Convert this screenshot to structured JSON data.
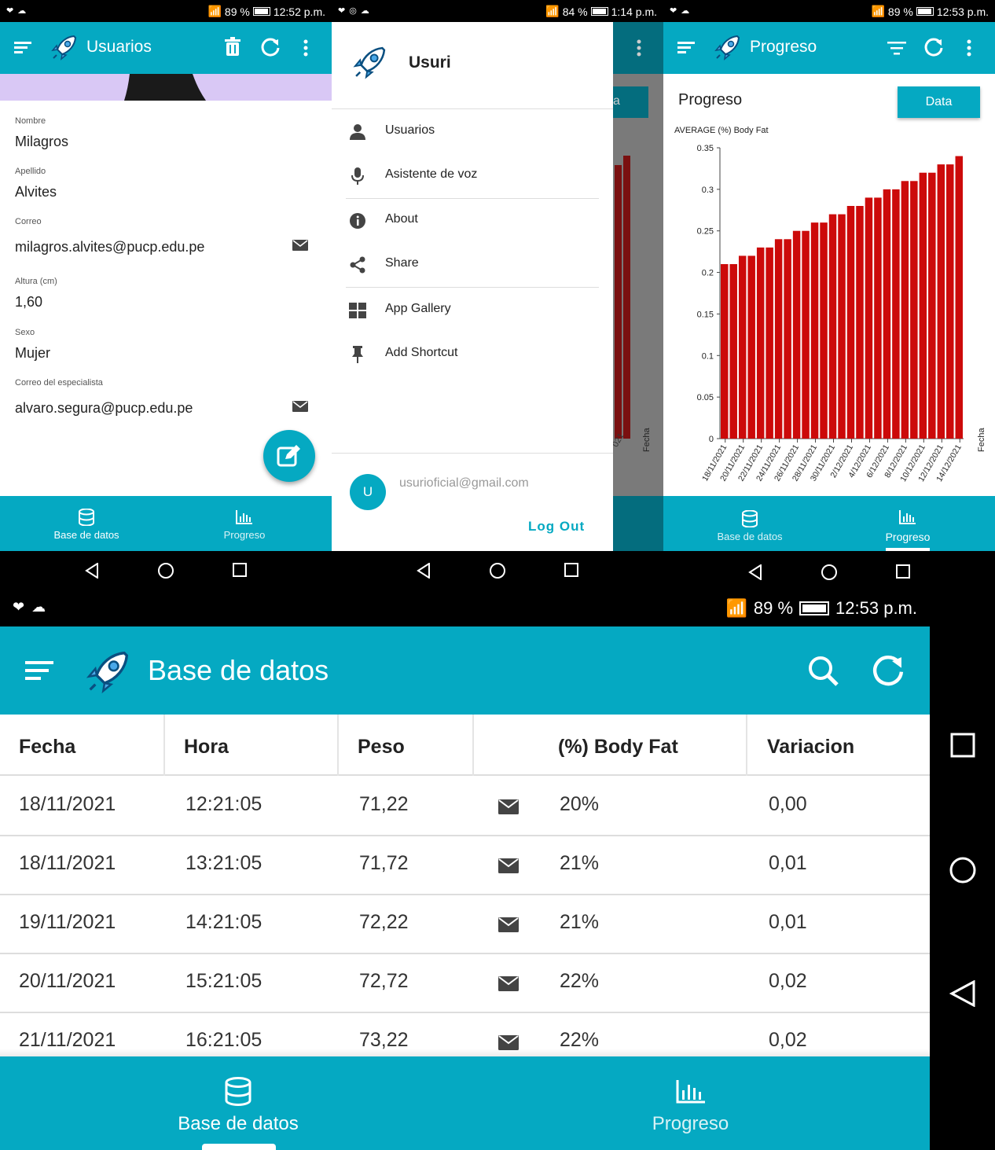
{
  "colors": {
    "primary": "#05a9c2",
    "bar": "#cc0a0a",
    "drawer_scrim": "#7a7a7a"
  },
  "screen1": {
    "status": {
      "left": "❤ ☁",
      "right": "89 %",
      "time": "12:52 p.m."
    },
    "appbar": {
      "title": "Usuarios",
      "icons": [
        "menu-icon",
        "rocket-logo",
        "trash-icon",
        "refresh-icon",
        "more-icon"
      ]
    },
    "fields": [
      {
        "label": "Nombre",
        "value": "Milagros"
      },
      {
        "label": "Apellido",
        "value": "Alvites"
      },
      {
        "label": "Correo",
        "value": "milagros.alvites@pucp.edu.pe"
      },
      {
        "label": "Altura (cm)",
        "value": "1,60"
      },
      {
        "label": "Sexo",
        "value": "Mujer"
      },
      {
        "label": "Correo del especialista",
        "value": "alvaro.segura@pucp.edu.pe"
      }
    ],
    "bottom_nav": {
      "db": "Base de datos",
      "progress": "Progreso"
    }
  },
  "screen2": {
    "status": {
      "left": "❤ ◎ ☁",
      "right": "84 %",
      "time": "1:14 p.m."
    },
    "drawer": {
      "app_name": "Usuri",
      "items": [
        "Usuarios",
        "Asistente de voz",
        "About",
        "Share",
        "App Gallery",
        "Add Shortcut"
      ],
      "avatar_letter": "U",
      "email": "usurioficial@gmail.com",
      "logout": "Log Out"
    },
    "behind": {
      "button_fragment": "a",
      "tick_fragment": "021",
      "axis_title": "Fecha"
    }
  },
  "screen3": {
    "status": {
      "left": "❤ ☁",
      "right": "89 %",
      "time": "12:53 p.m."
    },
    "appbar": {
      "title": "Progreso"
    },
    "card_title": "Progreso",
    "data_button": "Data",
    "bottom_nav": {
      "db": "Base de datos",
      "progress": "Progreso"
    }
  },
  "chart_data": {
    "type": "bar",
    "legend": "AVERAGE (%) Body Fat",
    "xlabel": "Fecha",
    "ylim": [
      0,
      0.35
    ],
    "yticks": [
      "0",
      "0.05",
      "0.1",
      "0.15",
      "0.2",
      "0.25",
      "0.3",
      "0.35"
    ],
    "xtick_labels": [
      "18/11/2021",
      "20/11/2021",
      "22/11/2021",
      "24/11/2021",
      "26/11/2021",
      "28/11/2021",
      "30/11/2021",
      "2/12/2021",
      "4/12/2021",
      "6/12/2021",
      "8/12/2021",
      "10/12/2021",
      "12/12/2021",
      "14/12/2021"
    ],
    "values": [
      0.21,
      0.21,
      0.22,
      0.22,
      0.23,
      0.23,
      0.24,
      0.24,
      0.25,
      0.25,
      0.26,
      0.26,
      0.27,
      0.27,
      0.28,
      0.28,
      0.29,
      0.29,
      0.3,
      0.3,
      0.31,
      0.31,
      0.32,
      0.32,
      0.33,
      0.33,
      0.34
    ]
  },
  "screen4": {
    "status": {
      "left": "❤ ☁",
      "right": "89 %",
      "time": "12:53 p.m."
    },
    "appbar": {
      "title": "Base de datos"
    },
    "table": {
      "headers": [
        "Fecha",
        "Hora",
        "Peso",
        "(%) Body Fat",
        "Variacion"
      ],
      "rows": [
        [
          "18/11/2021",
          "12:21:05",
          "71,22",
          "20%",
          "0,00"
        ],
        [
          "18/11/2021",
          "13:21:05",
          "71,72",
          "21%",
          "0,01"
        ],
        [
          "19/11/2021",
          "14:21:05",
          "72,22",
          "21%",
          "0,01"
        ],
        [
          "20/11/2021",
          "15:21:05",
          "72,72",
          "22%",
          "0,02"
        ],
        [
          "21/11/2021",
          "16:21:05",
          "73,22",
          "22%",
          "0,02"
        ]
      ]
    },
    "bottom_nav": {
      "db": "Base de datos",
      "progress": "Progreso"
    }
  }
}
